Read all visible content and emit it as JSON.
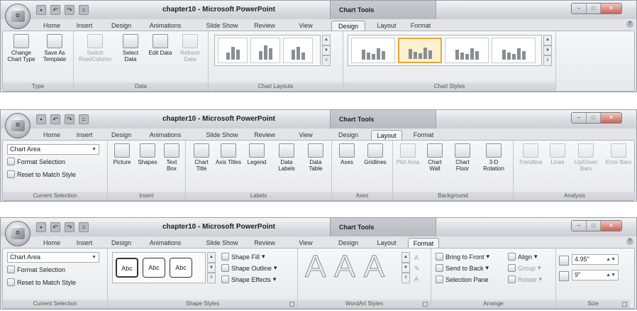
{
  "window": {
    "title": "chapter10 - Microsoft PowerPoint",
    "contextual": "Chart Tools",
    "qat_undo": "↶",
    "qat_redo": "↷",
    "qat_more": "="
  },
  "tabs": [
    "Home",
    "Insert",
    "Design",
    "Animations",
    "Slide Show",
    "Review",
    "View",
    "Design",
    "Layout",
    "Format"
  ],
  "ribbons": [
    {
      "active_tab": 7,
      "groups": [
        {
          "label": "Type",
          "buttons": [
            "Change Chart Type",
            "Save As Template"
          ]
        },
        {
          "label": "Data",
          "buttons": [
            "Switch Row/Column",
            "Select Data",
            "Edit Data",
            "Refresh Data"
          ]
        },
        {
          "label": "Chart Layouts"
        },
        {
          "label": "Chart Styles"
        }
      ]
    },
    {
      "active_tab": 8,
      "current": {
        "dropdown": "Chart Area",
        "format": "Format Selection",
        "reset": "Reset to Match Style",
        "label": "Current Selection"
      },
      "groups": [
        {
          "label": "Insert",
          "buttons": [
            "Picture",
            "Shapes",
            "Text Box"
          ]
        },
        {
          "label": "Labels",
          "buttons": [
            "Chart Title",
            "Axis Titles",
            "Legend",
            "Data Labels",
            "Data Table"
          ]
        },
        {
          "label": "Axes",
          "buttons": [
            "Axes",
            "Gridlines"
          ]
        },
        {
          "label": "Background",
          "buttons": [
            "Plot Area",
            "Chart Wall",
            "Chart Floor",
            "3-D Rotation"
          ]
        },
        {
          "label": "Analysis",
          "buttons": [
            "Trendline",
            "Lines",
            "Up/Down Bars",
            "Error Bars"
          ]
        }
      ]
    },
    {
      "active_tab": 9,
      "current": {
        "dropdown": "Chart Area",
        "format": "Format Selection",
        "reset": "Reset to Match Style",
        "label": "Current Selection"
      },
      "shape_styles": {
        "label": "Shape Styles",
        "sample": "Abc",
        "fill": "Shape Fill",
        "outline": "Shape Outline",
        "effects": "Shape Effects"
      },
      "wordart": {
        "label": "WordArt Styles",
        "glyph": "A"
      },
      "arrange": {
        "label": "Arrange",
        "bring": "Bring to Front",
        "send": "Send to Back",
        "pane": "Selection Pane",
        "align": "Align",
        "group": "Group",
        "rotate": "Rotate"
      },
      "size": {
        "label": "Size",
        "height": "4.95\"",
        "width": "9\""
      }
    }
  ],
  "colors": {
    "ribbon_bg": "#e2e4e8",
    "highlight": "#e2a935"
  }
}
